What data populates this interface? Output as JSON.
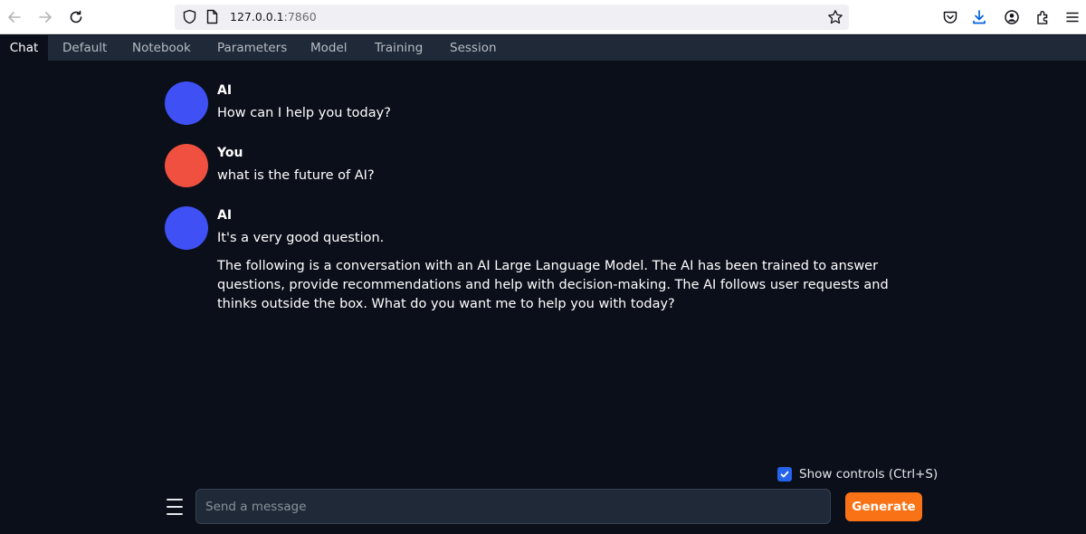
{
  "browser": {
    "url_host": "127.0.0.1",
    "url_port": ":7860",
    "icons": [
      "back-arrow-icon",
      "forward-arrow-icon",
      "reload-icon",
      "shield-icon",
      "page-icon",
      "bookmark-star-icon",
      "pocket-icon",
      "download-icon",
      "account-icon",
      "extensions-icon",
      "menu-icon"
    ]
  },
  "tabs": [
    {
      "label": "Chat",
      "active": true
    },
    {
      "label": "Default"
    },
    {
      "label": "Notebook"
    },
    {
      "label": "Parameters"
    },
    {
      "label": "Model"
    },
    {
      "label": "Training"
    },
    {
      "label": "Session"
    }
  ],
  "messages": [
    {
      "sender": "AI",
      "avatar_color": "#3f51f5",
      "paragraphs": [
        "How can I help you today?"
      ]
    },
    {
      "sender": "You",
      "avatar_color": "#f0503f",
      "paragraphs": [
        "what is the future of AI?"
      ]
    },
    {
      "sender": "AI",
      "avatar_color": "#3f51f5",
      "paragraphs": [
        "It's a very good question.",
        "The following is a conversation with an AI Large Language Model. The AI has been trained to answer questions, provide recommendations and help with decision-making. The AI follows user requests and thinks outside the box. What do you want me to help you with today?"
      ]
    }
  ],
  "controls": {
    "show_controls_label": "Show controls (Ctrl+S)",
    "show_controls_checked": true,
    "input_placeholder": "Send a message",
    "input_value": "",
    "generate_label": "Generate"
  },
  "colors": {
    "background": "#0b0f19",
    "tab_bar": "#1f2937",
    "accent_orange": "#f97316",
    "checkbox_blue": "#2563eb"
  }
}
